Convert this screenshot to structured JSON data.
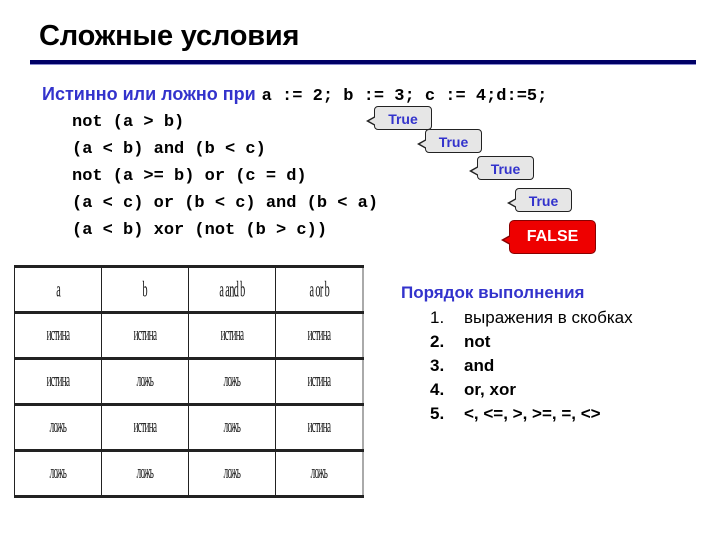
{
  "slide": {
    "title": "Сложные условия",
    "accent_color": "#3333cc",
    "rule_color": "#000066"
  },
  "question": {
    "text": "Истинно или ложно при",
    "vars": "a := 2; b := 3; c := 4;d:=5;"
  },
  "expressions": [
    "not (a > b)",
    "(a < b) and (b < c)",
    "not (a >= b) or (c = d)",
    "(a < c) or (b < c) and (b < a)",
    "(a < b) xor (not (b > c))"
  ],
  "results": [
    {
      "label": "True",
      "color": "#3333cc"
    },
    {
      "label": "True",
      "color": "#3333cc"
    },
    {
      "label": "True",
      "color": "#3333cc"
    },
    {
      "label": "True",
      "color": "#3333cc"
    },
    {
      "label": "FALSE",
      "color": "#ee0000"
    }
  ],
  "truth_table": {
    "headers": [
      "a",
      "b",
      "a and b",
      "a or b"
    ],
    "rows": [
      [
        "истина",
        "истина",
        "истина",
        "истина"
      ],
      [
        "истина",
        "ложь",
        "ложь",
        "истина"
      ],
      [
        "ложь",
        "истина",
        "ложь",
        "истина"
      ],
      [
        "ложь",
        "ложь",
        "ложь",
        "ложь"
      ]
    ]
  },
  "order": {
    "title": "Порядок выполнения",
    "items": [
      {
        "num": "1.",
        "text": "выражения в скобках"
      },
      {
        "num": "2.",
        "text": "not"
      },
      {
        "num": "3.",
        "text": "and"
      },
      {
        "num": "4.",
        "text": "or, xor"
      },
      {
        "num": "5.",
        "text": "<, <=, >, >=, =, <>"
      }
    ]
  }
}
